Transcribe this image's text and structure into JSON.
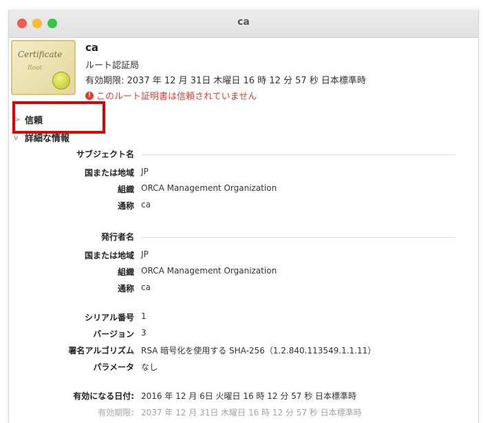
{
  "window": {
    "title": "ca"
  },
  "header": {
    "name": "ca",
    "subtitle": "ルート認証局",
    "expiry": "有効期限: 2037 年 12 月 31日 木曜日 16 時 12 分 57 秒 日本標準時",
    "warning": "このルート証明書は信頼されていません"
  },
  "icon": {
    "script": "Certificate",
    "script2": "Root"
  },
  "sections": {
    "trust": "信頼",
    "details": "詳細な情報"
  },
  "subject": {
    "heading": "サブジェクト名",
    "rows": [
      {
        "key": "国または地域",
        "value": "JP"
      },
      {
        "key": "組織",
        "value": "ORCA Management Organization"
      },
      {
        "key": "通称",
        "value": "ca"
      }
    ]
  },
  "issuer": {
    "heading": "発行者名",
    "rows": [
      {
        "key": "国または地域",
        "value": "JP"
      },
      {
        "key": "組織",
        "value": "ORCA Management Organization"
      },
      {
        "key": "通称",
        "value": "ca"
      }
    ]
  },
  "misc": {
    "rows": [
      {
        "key": "シリアル番号",
        "value": "1"
      },
      {
        "key": "バージョン",
        "value": "3"
      },
      {
        "key": "署名アルゴリズム",
        "value": "RSA 暗号化を使用する SHA-256（1.2.840.113549.1.1.11）"
      },
      {
        "key": "パラメータ",
        "value": "なし"
      }
    ]
  },
  "validity": {
    "rows": [
      {
        "key": "有効になる日付:",
        "value": "2016 年 12 月 6日 火曜日 16 時 12 分 57 秒 日本標準時"
      },
      {
        "key": "有効期限:",
        "value": "2037 年 12 月 31日 木曜日 16 時 12 分 57 秒 日本標準時"
      }
    ]
  },
  "colors": {
    "highlight": "#e00000",
    "warning": "#e23b30"
  }
}
